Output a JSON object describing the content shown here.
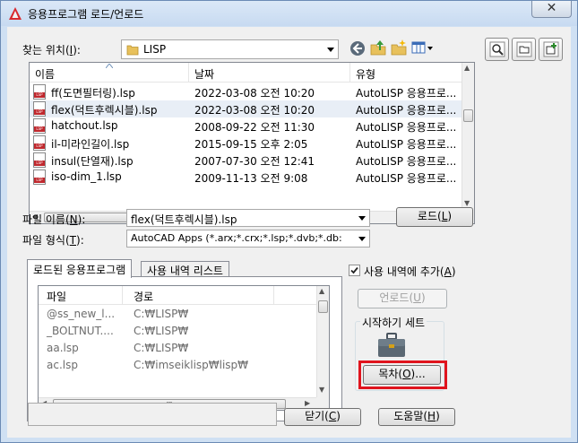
{
  "window": {
    "title": "응용프로그램 로드/언로드",
    "close_glyph": "✕"
  },
  "lookin": {
    "label": "찾는 위치",
    "accel": "I",
    "value": "LISP"
  },
  "files": {
    "columns": {
      "name": "이름",
      "date": "날짜",
      "type": "유형"
    },
    "rows": [
      {
        "name": "ff(도면필터링).lsp",
        "date": "2022-03-08 오전 10:20",
        "type": "AutoLISP 응용프로..."
      },
      {
        "name": "flex(덕트후렉시블).lsp",
        "date": "2022-03-08 오전 10:20",
        "type": "AutoLISP 응용프로..."
      },
      {
        "name": "hatchout.lsp",
        "date": "2008-09-22 오전 11:30",
        "type": "AutoLISP 응용프로..."
      },
      {
        "name": "il-미라인길이.lsp",
        "date": "2015-09-15 오후 2:05",
        "type": "AutoLISP 응용프로..."
      },
      {
        "name": "insul(단열재).lsp",
        "date": "2007-07-30 오전 12:41",
        "type": "AutoLISP 응용프로..."
      },
      {
        "name": "iso-dim_1.lsp",
        "date": "2009-11-13 오전 9:08",
        "type": "AutoLISP 응용프로..."
      }
    ],
    "selected_index": 1,
    "hscroll_grip": "III"
  },
  "filename": {
    "label": "파일 이름",
    "accel": "N",
    "value": "flex(덕트후렉시블).lsp"
  },
  "filetype": {
    "label": "파일 형식",
    "accel": "T",
    "value": "AutoCAD Apps (*.arx;*.crx;*.lsp;*.dvb;*.db:"
  },
  "load_button": {
    "label": "로드",
    "accel": "L"
  },
  "tabs": [
    {
      "label": "로드된 응용프로그램",
      "active": true
    },
    {
      "label": "사용 내역 리스트",
      "active": false
    }
  ],
  "loaded": {
    "columns": {
      "file": "파일",
      "path": "경로"
    },
    "rows": [
      {
        "file": "@ss_new_l...",
        "path": "C:₩LISP₩"
      },
      {
        "file": "_BOLTNUT....",
        "path": "C:₩LISP₩"
      },
      {
        "file": "aa.lsp",
        "path": "C:₩LISP₩"
      },
      {
        "file": "ac.lsp",
        "path": "C:₩imseiklisp₩lisp₩"
      }
    ],
    "hscroll_grip": "III"
  },
  "history": {
    "label": "사용 내역에 추가",
    "accel": "A",
    "checked": true
  },
  "unload_button": {
    "label": "언로드",
    "accel": "U"
  },
  "startup_suite": {
    "label": "시작하기 세트",
    "button": {
      "label": "목차",
      "accel": "O",
      "suffix": "..."
    },
    "highlight_color": "#e0141e"
  },
  "close_button": {
    "label": "닫기",
    "accel": "C"
  },
  "help_button": {
    "label": "도움말",
    "accel": "H"
  }
}
